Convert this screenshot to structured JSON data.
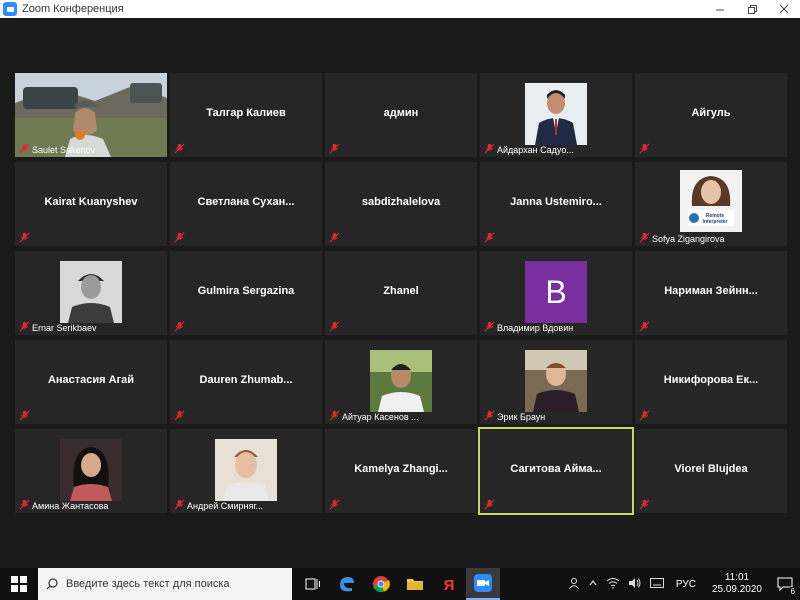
{
  "window": {
    "title": "Zoom Конференция",
    "accent": "#2d8cff"
  },
  "participants": [
    {
      "name": "Saulet Sakenov"
    },
    {
      "name": "Талгар Калиев"
    },
    {
      "name": "админ"
    },
    {
      "name": "Айдархан Садуо..."
    },
    {
      "name": "Айгуль"
    },
    {
      "name": "Kairat Kuanyshev"
    },
    {
      "name": "Светлана  Сухан..."
    },
    {
      "name": "sabdizhalelova"
    },
    {
      "name": "Janna  Ustemiro..."
    },
    {
      "name": "Sofya Zigangirova",
      "overlay": [
        "Remote",
        "Interpreter"
      ]
    },
    {
      "name": "Ernar Serikbaev"
    },
    {
      "name": "Gulmira Sergazina"
    },
    {
      "name": "Zhanel"
    },
    {
      "name": "Владимир Вдовин",
      "initial": "B",
      "avatar_color": "#7a2fa0"
    },
    {
      "name": "Нариман  Зейнн..."
    },
    {
      "name": "Анастасия Агай"
    },
    {
      "name": "Dauren  Zhumab..."
    },
    {
      "name": "Айтуар Касенов ..."
    },
    {
      "name": "Эрик Браун"
    },
    {
      "name": "Никифорова  Ек..."
    },
    {
      "name": "Амина Жантасова"
    },
    {
      "name": "Андрей Смирняг..."
    },
    {
      "name": "Kamelya  Zhangi..."
    },
    {
      "name": "Сагитова  Айма...",
      "active_speaker": true
    },
    {
      "name": "Viorel Blujdea"
    }
  ],
  "taskbar": {
    "search_placeholder": "Введите здесь текст для поиска",
    "language": "РУС",
    "time": "11:01",
    "date": "25.09.2020",
    "notifications": "6"
  }
}
